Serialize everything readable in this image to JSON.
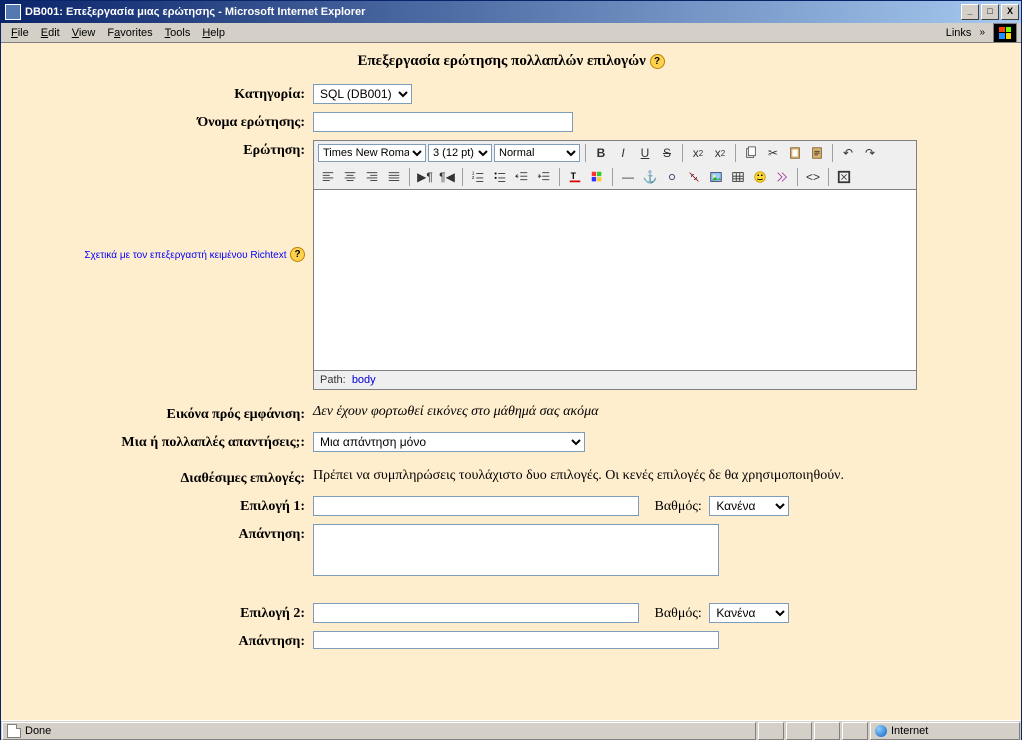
{
  "window": {
    "title": "DB001: Επεξεργασία μιας ερώτησης - Microsoft Internet Explorer",
    "min": "_",
    "max": "□",
    "close": "X"
  },
  "menu": {
    "file": "File",
    "edit": "Edit",
    "view": "View",
    "favorites": "Favorites",
    "tools": "Tools",
    "help": "Help",
    "links": "Links"
  },
  "page": {
    "title": "Επεξεργασία ερώτησης πολλαπλών επιλογών",
    "labels": {
      "category": "Κατηγορία:",
      "question_name": "Όνομα ερώτησης:",
      "question": "Ερώτηση:",
      "about_editor": "Σχετικά με τον επεξεργαστή κειμένου Richtext",
      "image_to_display": "Εικόνα πρός εμφάνιση:",
      "one_or_many": "Μια ή πολλαπλές απαντήσεις;:",
      "available_choices": "Διαθέσιμες επιλογές:",
      "choice1": "Επιλογή 1:",
      "choice2": "Επιλογή 2:",
      "answer": "Απάντηση:",
      "grade": "Βαθμός:"
    },
    "values": {
      "category_selected": "SQL (DB001)",
      "question_name": "",
      "font_family": "Times New Roman",
      "font_size": "3 (12 pt)",
      "style": "Normal",
      "path_label": "Path:",
      "path_body": "body",
      "image_msg": "Δεν έχουν φορτωθεί εικόνες στο μάθημά σας ακόμα",
      "one_or_many_selected": "Μια απάντηση μόνο",
      "available_msg": "Πρέπει να συμπληρώσεις τουλάχιστο δυο επιλογές. Οι κενές επιλογές δε θα χρησιμοποιηθούν.",
      "choice1_value": "",
      "choice2_value": "",
      "grade1": "Κανένα",
      "grade2": "Κανένα",
      "answer1": "",
      "answer2": ""
    }
  },
  "toolbar": {
    "bold": "B",
    "italic": "I",
    "underline": "U",
    "strike": "S",
    "undo": "↶",
    "redo": "↷"
  },
  "status": {
    "done": "Done",
    "zone": "Internet"
  }
}
